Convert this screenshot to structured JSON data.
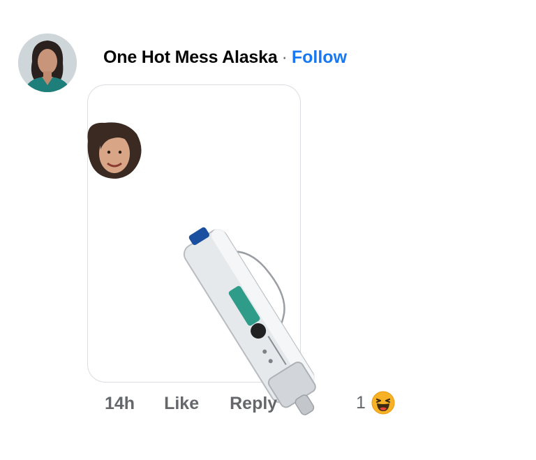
{
  "comment": {
    "author": "One Hot Mess Alaska",
    "separator": "·",
    "follow_label": "Follow",
    "timestamp": "14h",
    "like_label": "Like",
    "reply_label": "Reply",
    "reaction_count": "1",
    "reaction_icon": "haha-emoji-icon"
  },
  "colors": {
    "follow": "#1877f2",
    "meta_text": "#65676b",
    "author_text": "#050505"
  }
}
